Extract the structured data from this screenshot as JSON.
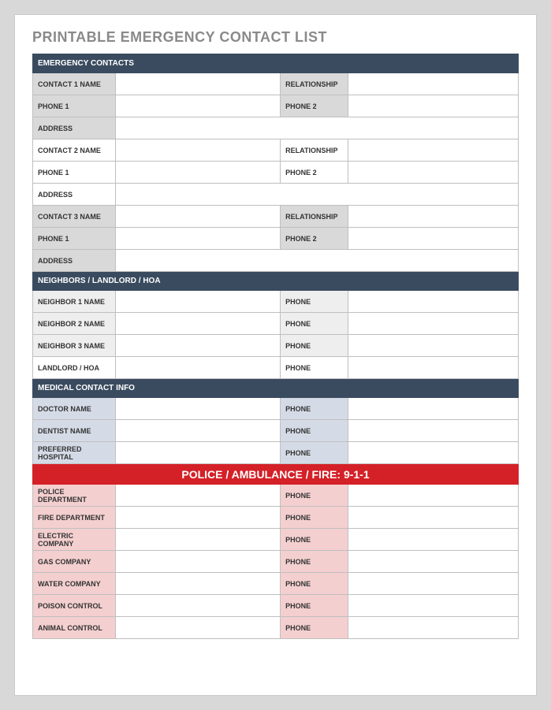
{
  "title": "PRINTABLE EMERGENCY CONTACT LIST",
  "sections": {
    "emergency": {
      "header": "EMERGENCY CONTACTS",
      "contacts": [
        {
          "name_lbl": "CONTACT 1 NAME",
          "rel_lbl": "RELATIONSHIP",
          "phone1_lbl": "PHONE 1",
          "phone2_lbl": "PHONE 2",
          "addr_lbl": "ADDRESS"
        },
        {
          "name_lbl": "CONTACT 2 NAME",
          "rel_lbl": "RELATIONSHIP",
          "phone1_lbl": "PHONE 1",
          "phone2_lbl": "PHONE 2",
          "addr_lbl": "ADDRESS"
        },
        {
          "name_lbl": "CONTACT 3 NAME",
          "rel_lbl": "RELATIONSHIP",
          "phone1_lbl": "PHONE 1",
          "phone2_lbl": "PHONE 2",
          "addr_lbl": "ADDRESS"
        }
      ]
    },
    "neighbors": {
      "header": "NEIGHBORS / LANDLORD / HOA",
      "rows": [
        {
          "name_lbl": "NEIGHBOR 1 NAME",
          "phone_lbl": "PHONE"
        },
        {
          "name_lbl": "NEIGHBOR 2 NAME",
          "phone_lbl": "PHONE"
        },
        {
          "name_lbl": "NEIGHBOR 3 NAME",
          "phone_lbl": "PHONE"
        },
        {
          "name_lbl": "LANDLORD / HOA",
          "phone_lbl": "PHONE"
        }
      ]
    },
    "medical": {
      "header": "MEDICAL CONTACT INFO",
      "rows": [
        {
          "name_lbl": "DOCTOR NAME",
          "phone_lbl": "PHONE"
        },
        {
          "name_lbl": "DENTIST NAME",
          "phone_lbl": "PHONE"
        },
        {
          "name_lbl": "PREFERRED HOSPITAL",
          "phone_lbl": "PHONE"
        }
      ]
    },
    "emergency911": {
      "header": "POLICE / AMBULANCE / FIRE:  9-1-1",
      "rows": [
        {
          "name_lbl": "POLICE DEPARTMENT",
          "phone_lbl": "PHONE"
        },
        {
          "name_lbl": "FIRE DEPARTMENT",
          "phone_lbl": "PHONE"
        },
        {
          "name_lbl": "ELECTRIC COMPANY",
          "phone_lbl": "PHONE"
        },
        {
          "name_lbl": "GAS COMPANY",
          "phone_lbl": "PHONE"
        },
        {
          "name_lbl": "WATER COMPANY",
          "phone_lbl": "PHONE"
        },
        {
          "name_lbl": "POISON CONTROL",
          "phone_lbl": "PHONE"
        },
        {
          "name_lbl": "ANIMAL CONTROL",
          "phone_lbl": "PHONE"
        }
      ]
    }
  }
}
